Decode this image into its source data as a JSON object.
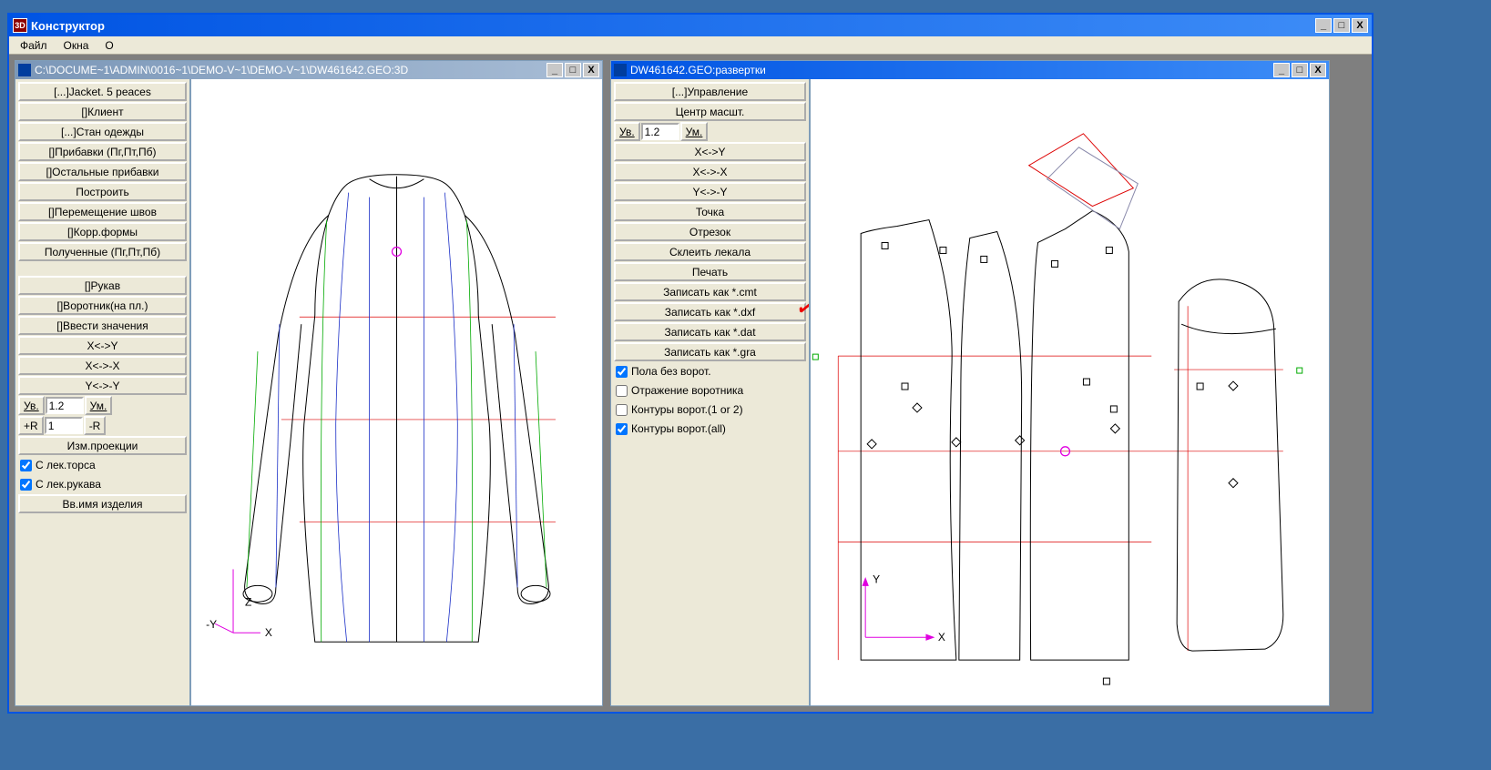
{
  "app": {
    "title": "Конструктор",
    "menu": {
      "file": "Файл",
      "windows": "Окна",
      "about": "О"
    }
  },
  "winLeft": {
    "title": "C:\\DOCUME~1\\ADMIN\\0016~1\\DEMO-V~1\\DEMO-V~1\\DW461642.GEO:3D",
    "buttons": {
      "b1": "[...]Jacket. 5 peaces",
      "b2": "[]Клиент",
      "b3": "[...]Стан одежды",
      "b4": "[]Прибавки (Пг,Пт,Пб)",
      "b5": "[]Остальные прибавки",
      "b6": "Построить",
      "b7": "[]Перемещение швов",
      "b8": "[]Корр.формы",
      "b9": "Полученные (Пг,Пт,Пб)",
      "b10": "[]Рукав",
      "b11": "[]Воротник(на пл.)",
      "b12": "[]Ввести значения",
      "b13": "X<->Y",
      "b14": "X<->-X",
      "b15": "Y<->-Y",
      "b16": "Изм.проекции",
      "b17": "Вв.имя изделия"
    },
    "zoom": {
      "uv": "Ув.",
      "val": "1.2",
      "um": "Ум."
    },
    "radius": {
      "plus": "+R",
      "val": "1",
      "minus": "-R"
    },
    "checks": {
      "c1": {
        "label": "С лек.торса",
        "checked": true
      },
      "c2": {
        "label": "С лек.рукава",
        "checked": true
      }
    }
  },
  "winRight": {
    "title": "DW461642.GEO:развертки",
    "buttons": {
      "b1": "[...]Управление",
      "b2": "Центр масшт.",
      "b3": "X<->Y",
      "b4": "X<->-X",
      "b5": "Y<->-Y",
      "b6": "Точка",
      "b7": "Отрезок",
      "b8": "Склеить лекала",
      "b9": "Печать",
      "b10": "Записать как *.cmt",
      "b11": "Записать как *.dxf",
      "b12": "Записать как *.dat",
      "b13": "Записать как *.gra"
    },
    "zoom": {
      "uv": "Ув.",
      "val": "1.2",
      "um": "Ум."
    },
    "checks": {
      "c1": {
        "label": "Пола без ворот.",
        "checked": true
      },
      "c2": {
        "label": "Отражение воротника",
        "checked": false
      },
      "c3": {
        "label": "Контуры ворот.(1 or 2)",
        "checked": false
      },
      "c4": {
        "label": "Контуры ворот.(all)",
        "checked": true
      }
    }
  },
  "axis": {
    "x": "X",
    "y": "Y",
    "z": "Z",
    "neg_y": "-Y"
  }
}
